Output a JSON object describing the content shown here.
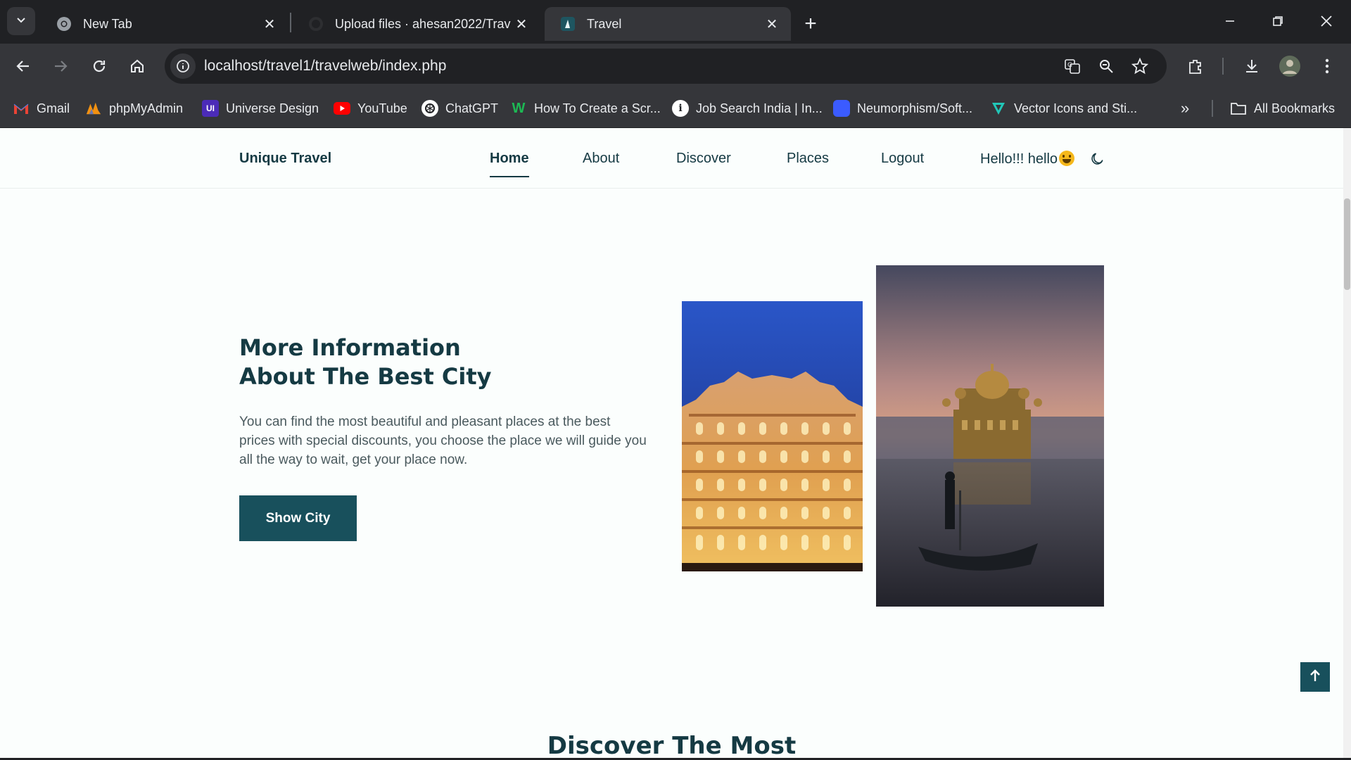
{
  "browser": {
    "tabs": [
      {
        "title": "New Tab",
        "icon": "chrome-icon",
        "active": false
      },
      {
        "title": "Upload files · ahesan2022/Trave",
        "icon": "github-icon",
        "active": false
      },
      {
        "title": "Travel",
        "icon": "travel-favicon",
        "active": true
      }
    ],
    "url": "localhost/travel1/travelweb/index.php",
    "bookmarks": [
      {
        "label": "Gmail",
        "icon": "gmail-icon",
        "color": "#ea4335"
      },
      {
        "label": "phpMyAdmin",
        "icon": "phpmyadmin-icon",
        "color": "#f29111"
      },
      {
        "label": "Universe Design",
        "icon": "ui-icon",
        "color": "#4b2bb8"
      },
      {
        "label": "YouTube",
        "icon": "youtube-icon",
        "color": "#ff0000"
      },
      {
        "label": "ChatGPT",
        "icon": "chatgpt-icon",
        "color": "#ffffff"
      },
      {
        "label": "How To Create a Scr...",
        "icon": "w-icon",
        "color": "#1db954"
      },
      {
        "label": "Job Search India | In...",
        "icon": "info-icon",
        "color": "#ffffff"
      },
      {
        "label": "Neumorphism/Soft...",
        "icon": "neumorphism-icon",
        "color": "#3b5bff"
      },
      {
        "label": "Vector Icons and Sti...",
        "icon": "vector-icon",
        "color": "#21c7b8"
      }
    ],
    "all_bookmarks": "All Bookmarks"
  },
  "site": {
    "brand": "Unique Travel",
    "nav": [
      "Home",
      "About",
      "Discover",
      "Places",
      "Logout"
    ],
    "active_nav": "Home",
    "greeting": "Hello!!! hello",
    "hero": {
      "title_line1": "More Information",
      "title_line2": "About The Best City",
      "text": "You can find the most beautiful and pleasant places at the best prices with special discounts, you choose the place we will guide you all the way to wait, get your place now.",
      "button": "Show City"
    },
    "next_section_title": "Discover The Most"
  },
  "colors": {
    "primary": "#18505c",
    "heading": "#153a43",
    "background": "#fbfefd"
  }
}
